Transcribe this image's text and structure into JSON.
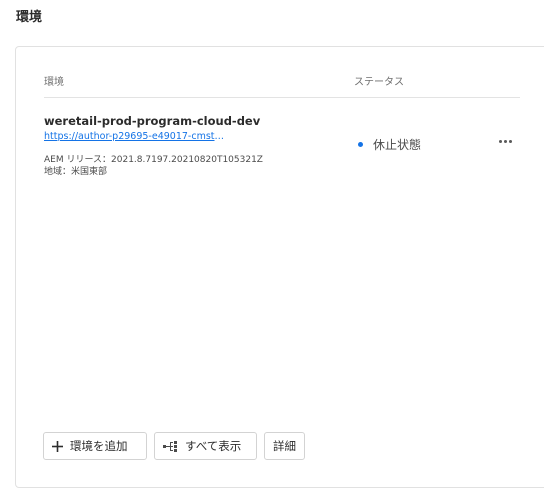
{
  "page": {
    "title": "環境"
  },
  "table": {
    "headers": {
      "environment": "環境",
      "status": "ステータス"
    },
    "rows": [
      {
        "name": "weretail-prod-program-cloud-dev",
        "url": "https://author-p29695-e49017-cmstg.a...",
        "release": "AEM リリース：2021.8.7197.20210820T105321Z",
        "region": "地域：米国東部",
        "status": "休止状態",
        "status_color": "#1473e6"
      }
    ]
  },
  "actions": {
    "add_environment": "環境を追加",
    "show_all": "すべて表示",
    "details": "詳細"
  },
  "icons": {
    "add": "plus-icon",
    "show_all": "tree-view-icon",
    "more": "more-icon"
  }
}
